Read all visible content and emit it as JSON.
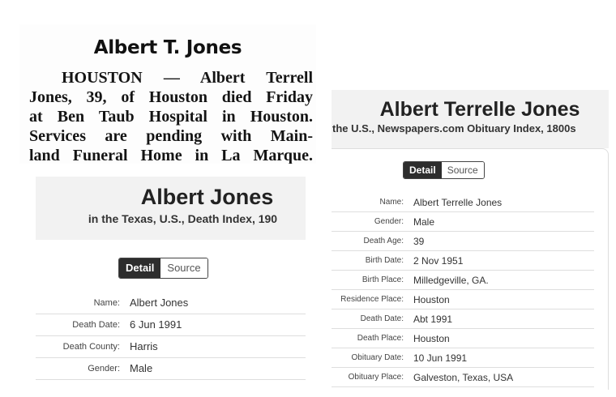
{
  "clipping": {
    "title": "Albert T. Jones",
    "lines": [
      "HOUSTON — Albert Terrell",
      "Jones, 39, of Houston died Friday",
      "at Ben Taub Hospital in Houston.",
      "Services are pending with Main-",
      "land Funeral Home in La Marque."
    ]
  },
  "texas_record": {
    "title": "Albert Jones",
    "subtitle": "in the Texas, U.S., Death Index, 190",
    "tabs": {
      "detail": "Detail",
      "source": "Source"
    },
    "fields": [
      {
        "label": "Name:",
        "value": "Albert Jones"
      },
      {
        "label": "Death Date:",
        "value": "6 Jun 1991"
      },
      {
        "label": "Death County:",
        "value": "Harris"
      },
      {
        "label": "Gender:",
        "value": "Male"
      }
    ]
  },
  "obituary_record": {
    "title": "Albert Terrelle Jones",
    "subtitle": "the U.S., Newspapers.com Obituary Index, 1800s",
    "tabs": {
      "detail": "Detail",
      "source": "Source"
    },
    "fields": [
      {
        "label": "Name:",
        "value": "Albert Terrelle Jones"
      },
      {
        "label": "Gender:",
        "value": "Male"
      },
      {
        "label": "Death Age:",
        "value": "39"
      },
      {
        "label": "Birth Date:",
        "value": "2 Nov 1951"
      },
      {
        "label": "Birth Place:",
        "value": "Milledgeville, GA."
      },
      {
        "label": "Residence Place:",
        "value": "Houston"
      },
      {
        "label": "Death Date:",
        "value": "Abt 1991"
      },
      {
        "label": "Death Place:",
        "value": "Houston"
      },
      {
        "label": "Obituary Date:",
        "value": "10 Jun 1991"
      },
      {
        "label": "Obituary Place:",
        "value": "Galveston, Texas, USA"
      }
    ]
  }
}
